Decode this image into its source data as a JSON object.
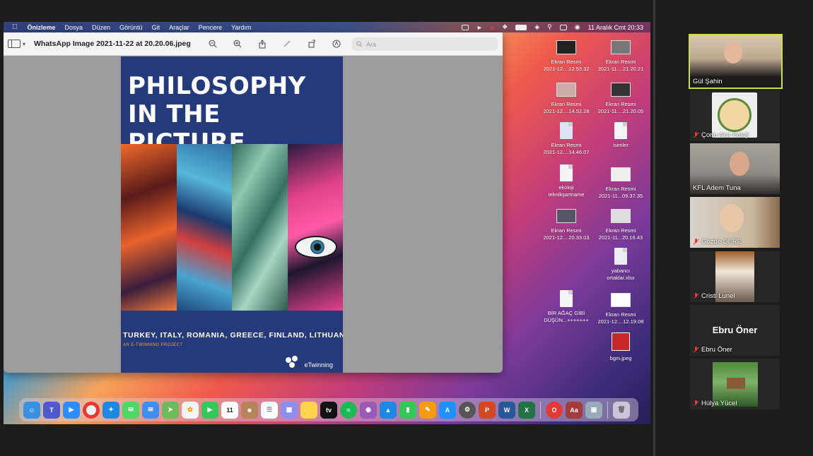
{
  "menubar": {
    "app_name": "Önizleme",
    "menus": [
      "Dosya",
      "Düzen",
      "Görüntü",
      "Git",
      "Araçlar",
      "Pencere",
      "Yardım"
    ],
    "datetime": "11 Aralık Cmt  20:33"
  },
  "preview": {
    "doc_title": "WhatsApp Image 2021-11-22 at 20.20.06.jpeg",
    "search_placeholder": "Ara"
  },
  "cover": {
    "title_line1": "PHILOSOPHY",
    "title_line2": "IN THE PICTURE",
    "countries": "TURKEY, ITALY, ROMANIA, GREECE, FINLAND, LITHUANIA",
    "subtitle": "AN E-TWINNING PROJECT",
    "brand": "eTwinning"
  },
  "desktop_icons": [
    {
      "line1": "Ekran Resmi",
      "line2": "2021-12....12.53.32"
    },
    {
      "line1": "Ekran Resmi",
      "line2": "2021-11....21.20.21"
    },
    {
      "line1": "Ekran Resmi",
      "line2": "2021-12....14.52.28"
    },
    {
      "line1": "Ekran Resmi",
      "line2": "2021-11....21.20.05"
    },
    {
      "line1": "Ekran Resmi",
      "line2": "2021-12....14.46.07"
    },
    {
      "line1": "isimler",
      "line2": ""
    },
    {
      "line1": "ekoloji",
      "line2": "teknikşartname"
    },
    {
      "line1": "Ekran Resmi",
      "line2": "2021-11...09.37.35"
    },
    {
      "line1": "Ekran Resmi",
      "line2": "2021-12....20.33.03"
    },
    {
      "line1": "Ekran Resmi",
      "line2": "2021-11...20.16.43"
    },
    {
      "line1": "yabancı",
      "line2": "ortaklar.xlsx"
    },
    {
      "line1": "BİR AĞAÇ GİBİ",
      "line2": "DÜŞÜN...+++++++"
    },
    {
      "line1": "Ekran Resmi",
      "line2": "2021-12....12.19.08"
    },
    {
      "line1": "bgm.jpeg",
      "line2": ""
    }
  ],
  "dock": {
    "calendar_day": "11",
    "tv_label": "tv",
    "dictionary_label": "Aa"
  },
  "participants": [
    {
      "name": "Gül Şahin",
      "muted": false
    },
    {
      "name": "Çorlu Aka Koleji",
      "muted": true
    },
    {
      "name": "KFL Adem Tuna",
      "muted": false
    },
    {
      "name": "Gözde DERE",
      "muted": true
    },
    {
      "name": "Cristi Lunel",
      "muted": true
    },
    {
      "name": "Ebru Öner",
      "muted": true,
      "display_text": "Ebru Öner"
    },
    {
      "name": "Hülya Yücel",
      "muted": true
    }
  ],
  "colors": {
    "active_speaker": "#c7e245",
    "muted_mic": "#e53935",
    "cover_bg": "#243a7a"
  }
}
